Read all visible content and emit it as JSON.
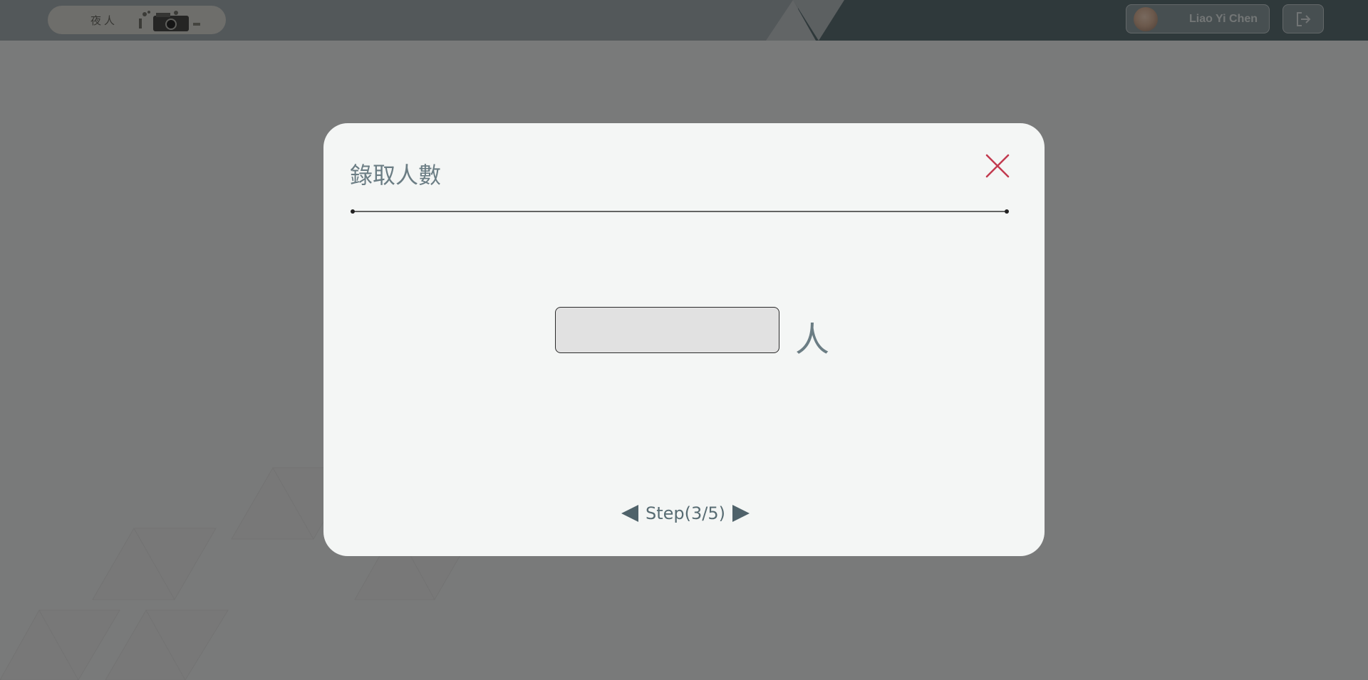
{
  "header": {
    "logo_text": "夜人",
    "user_name": "Liao Yi Chen",
    "logout_icon": "logout-icon",
    "avatar": "user-avatar"
  },
  "modal": {
    "title": "錄取人數",
    "close_icon": "close-icon",
    "input": {
      "value": "",
      "placeholder": ""
    },
    "unit": "人",
    "step_label": "Step(3/5)",
    "prev_icon": "triangle-left-icon",
    "next_icon": "triangle-right-icon"
  },
  "colors": {
    "close": "#c23a4f",
    "title_text": "#6b7d84",
    "arrow": "#4f626a",
    "modal_bg": "#f4f6f5",
    "overlay": "rgba(0,0,0,0.5)"
  }
}
